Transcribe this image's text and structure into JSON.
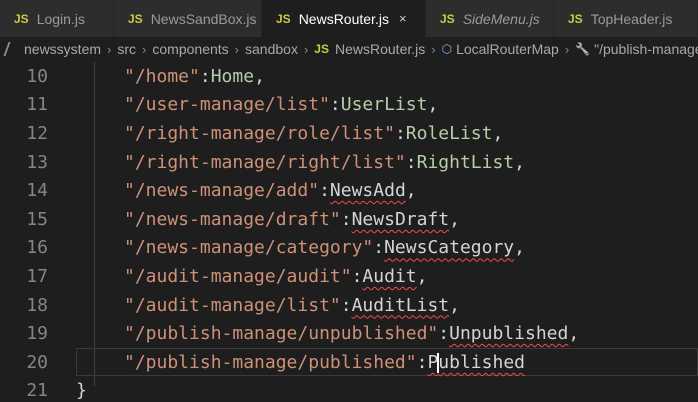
{
  "tabs": [
    {
      "icon": "JS",
      "label": "Login.js",
      "active": false,
      "italic": false
    },
    {
      "icon": "JS",
      "label": "NewsSandBox.js",
      "active": false,
      "italic": false
    },
    {
      "icon": "JS",
      "label": "NewsRouter.js",
      "active": true,
      "italic": false,
      "close": "×"
    },
    {
      "icon": "JS",
      "label": "SideMenu.js",
      "active": false,
      "italic": true
    },
    {
      "icon": "JS",
      "label": "TopHeader.js",
      "active": false,
      "italic": false
    }
  ],
  "breadcrumb": {
    "items": [
      "newssystem",
      "src",
      "components",
      "sandbox",
      "NewsRouter.js",
      "LocalRouterMap",
      "\"/publish-manage"
    ],
    "file_icon": "JS",
    "separator": "›"
  },
  "lines": [
    {
      "num": "10",
      "key": "\"/home\"",
      "value": "Home",
      "tail": ",",
      "green": true,
      "squiggle": false
    },
    {
      "num": "11",
      "key": "\"/user-manage/list\"",
      "value": "UserList",
      "tail": ",",
      "green": true,
      "squiggle": false
    },
    {
      "num": "12",
      "key": "\"/right-manage/role/list\"",
      "value": "RoleList",
      "tail": ",",
      "green": true,
      "squiggle": false
    },
    {
      "num": "13",
      "key": "\"/right-manage/right/list\"",
      "value": "RightList",
      "tail": ",",
      "green": true,
      "squiggle": false
    },
    {
      "num": "14",
      "key": "\"/news-manage/add\"",
      "value": "NewsAdd",
      "tail": ",",
      "green": false,
      "squiggle": true
    },
    {
      "num": "15",
      "key": "\"/news-manage/draft\"",
      "value": "NewsDraft",
      "tail": ",",
      "green": false,
      "squiggle": true
    },
    {
      "num": "16",
      "key": "\"/news-manage/category\"",
      "value": "NewsCategory",
      "tail": ",",
      "green": false,
      "squiggle": true
    },
    {
      "num": "17",
      "key": "\"/audit-manage/audit\"",
      "value": "Audit",
      "tail": ",",
      "green": false,
      "squiggle": true
    },
    {
      "num": "18",
      "key": "\"/audit-manage/list\"",
      "value": "AuditList",
      "tail": ",",
      "green": false,
      "squiggle": true
    },
    {
      "num": "19",
      "key": "\"/publish-manage/unpublished\"",
      "value": "Unpublished",
      "tail": ",",
      "green": false,
      "squiggle": true
    },
    {
      "num": "20",
      "key": "\"/publish-manage/published\"",
      "value": "Published",
      "tail": "",
      "green": false,
      "squiggle": true,
      "current": true
    },
    {
      "num": "21",
      "key": "",
      "value": "",
      "tail": "",
      "brace": "}"
    }
  ],
  "colors": {
    "editor_bg": "#1e1e1e",
    "string": "#ce9178",
    "identifier": "#b5cea8",
    "error_squiggle": "#f14c4c",
    "js_icon": "#cbcb41"
  }
}
